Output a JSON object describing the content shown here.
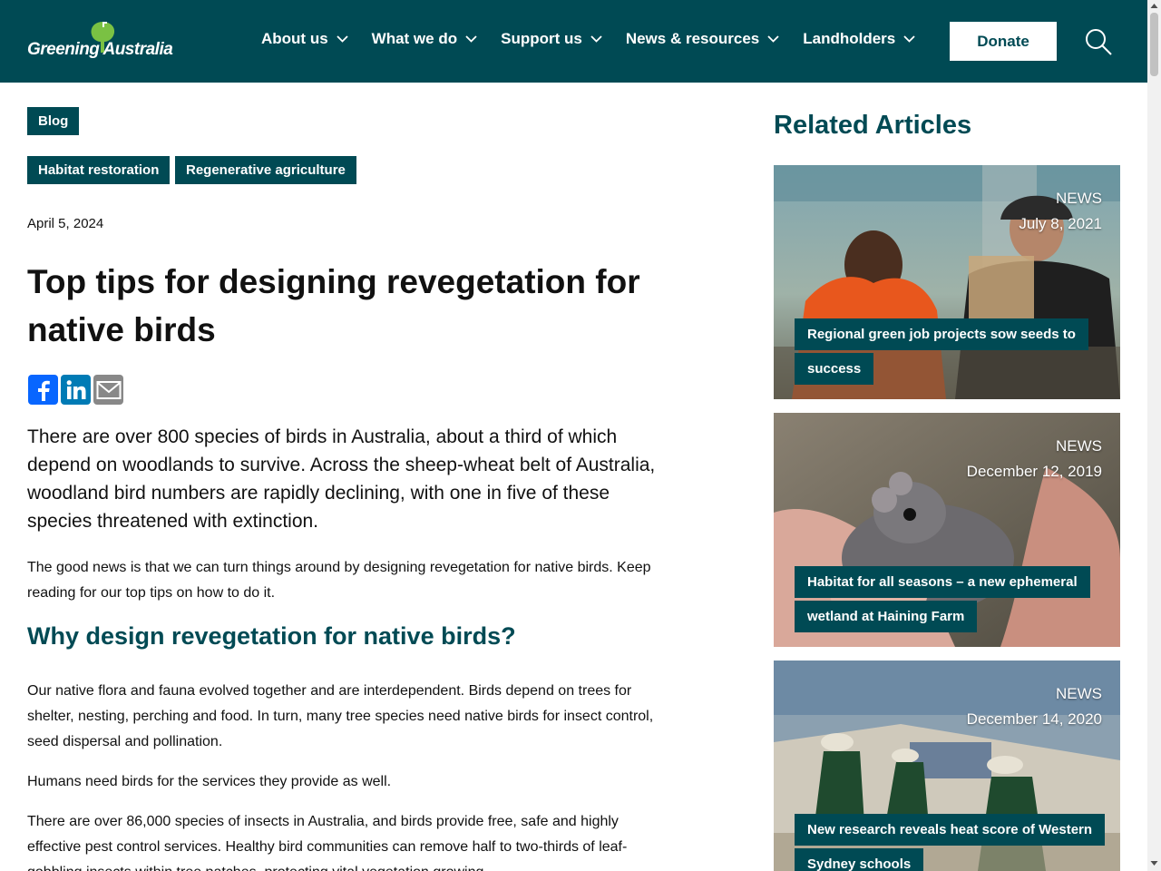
{
  "header": {
    "logo_text": "Greening Australia",
    "nav": [
      {
        "label": "About us"
      },
      {
        "label": "What we do"
      },
      {
        "label": "Support us"
      },
      {
        "label": "News & resources"
      },
      {
        "label": "Landholders"
      }
    ],
    "donate_label": "Donate"
  },
  "article": {
    "category": "Blog",
    "tags": [
      "Habitat restoration",
      "Regenerative agriculture"
    ],
    "date": "April 5, 2024",
    "title": "Top tips for designing revegetation for native birds",
    "lead": "There are over 800 species of birds in Australia, about a third of which depend on woodlands to survive. Across the sheep-wheat belt of Australia, woodland bird numbers are rapidly declining, with one in five of these species threatened with extinction.",
    "intro": "The good news is that we can turn things around by designing revegetation for native birds. Keep reading for our top tips on how to do it.",
    "section_heading": "Why design revegetation for native birds?",
    "p1": "Our native flora and fauna evolved together and are interdependent. Birds depend on trees for shelter, nesting, perching and food. In turn, many tree species need native birds for insect control, seed dispersal and pollination.",
    "p2": "Humans need birds for the services they provide as well.",
    "p3": "There are over 86,000 species of insects in Australia, and birds provide free, safe and highly effective pest control services. Healthy bird communities can remove half to two-thirds of leaf-gobbling insects within tree patches, protecting vital vegetation growing"
  },
  "share": {
    "facebook_icon": "facebook-icon",
    "linkedin_icon": "linkedin-icon",
    "email_icon": "email-icon"
  },
  "sidebar": {
    "heading": "Related Articles",
    "cards": [
      {
        "type": "NEWS",
        "date": "July 8, 2021",
        "title": "Regional green job projects sow seeds to success"
      },
      {
        "type": "NEWS",
        "date": "December 12, 2019",
        "title": "Habitat for all seasons – a new ephemeral wetland at Haining Farm"
      },
      {
        "type": "NEWS",
        "date": "December 14, 2020",
        "title": "New research reveals heat score of Western Sydney schools"
      }
    ]
  },
  "colors": {
    "brand": "#004a54",
    "logo_green": "#7ac143"
  }
}
